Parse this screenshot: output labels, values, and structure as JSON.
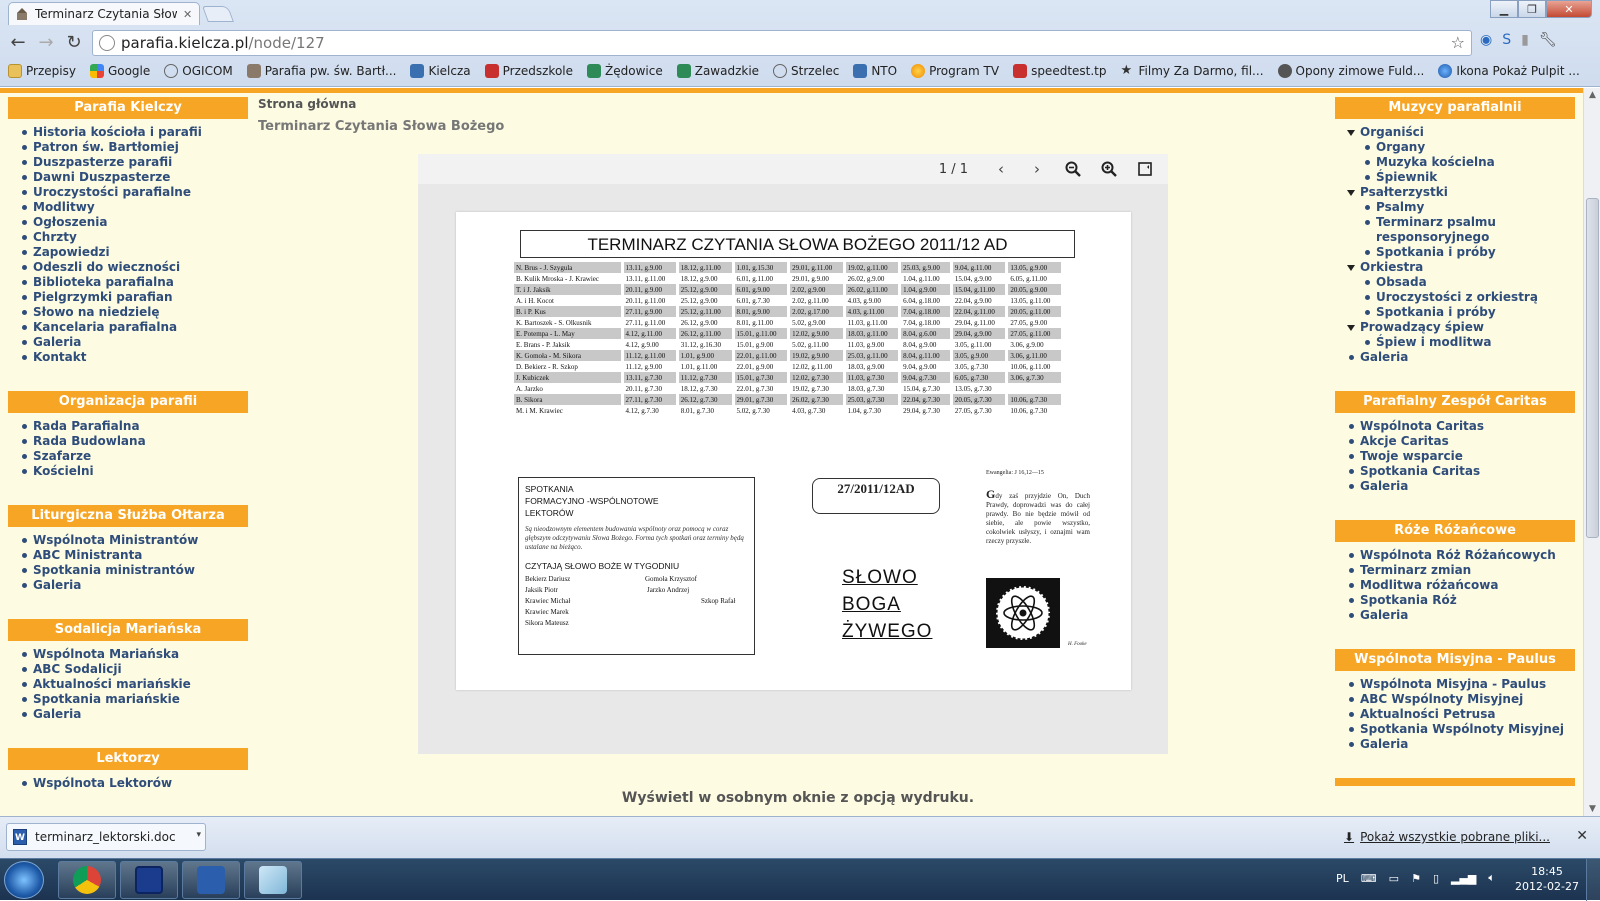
{
  "browser": {
    "tab_title": "Terminarz Czytania Słowa B",
    "url_host": "parafia.kielcza.pl",
    "url_path": "/node/127",
    "bookmarks": [
      {
        "label": "Przepisy",
        "icon": "folder-icon"
      },
      {
        "label": "Google",
        "icon": "google-icon"
      },
      {
        "label": "OGICOM",
        "icon": "ogicom-icon"
      },
      {
        "label": "Parafia pw. św. Bartł...",
        "icon": "church-icon"
      },
      {
        "label": "Kielcza",
        "icon": "kielcza-icon"
      },
      {
        "label": "Przedszkole",
        "icon": "school-icon"
      },
      {
        "label": "Żędowice",
        "icon": "zedowice-icon"
      },
      {
        "label": "Zawadzkie",
        "icon": "zawadzkie-icon"
      },
      {
        "label": "Strzelec",
        "icon": "strzelec-icon"
      },
      {
        "label": "NTO",
        "icon": "nto-icon"
      },
      {
        "label": "Program TV",
        "icon": "tv-icon"
      },
      {
        "label": "speedtest.tp",
        "icon": "speedtest-icon"
      },
      {
        "label": "Filmy Za Darmo, fil...",
        "icon": "star-icon"
      },
      {
        "label": "Opony zimowe Fuld...",
        "icon": "tire-icon"
      },
      {
        "label": "Ikona Pokaż Pulpit ...",
        "icon": "globe-icon"
      }
    ]
  },
  "page": {
    "breadcrumb": "Strona główna",
    "title": "Terminarz Czytania Słowa Bożego",
    "print_link": "Wyświetl w osobnym oknie z opcją wydruku."
  },
  "left_sidebar": [
    {
      "title": "Parafia Kielczy",
      "items": [
        "Historia kościoła i parafii",
        "Patron św. Bartłomiej",
        "Duszpasterze parafii",
        "Dawni Duszpasterze",
        "Uroczystości parafialne",
        "Modlitwy",
        "Ogłoszenia",
        "Chrzty",
        "Zapowiedzi",
        "Odeszli do wieczności",
        "Biblioteka parafialna",
        "Pielgrzymki parafian",
        "Słowo na niedzielę",
        "Kancelaria parafialna",
        "Galeria",
        "Kontakt"
      ]
    },
    {
      "title": "Organizacja parafii",
      "items": [
        "Rada Parafialna",
        "Rada Budowlana",
        "Szafarze",
        "Kościelni"
      ]
    },
    {
      "title": "Liturgiczna Służba Ołtarza",
      "items": [
        "Wspólnota Ministrantów",
        "ABC Ministranta",
        "Spotkania ministrantów",
        "Galeria"
      ]
    },
    {
      "title": "Sodalicja Mariańska",
      "items": [
        "Wspólnota Mariańska",
        "ABC Sodalicji",
        "Aktualności mariańskie",
        "Spotkania mariańskie",
        "Galeria"
      ]
    },
    {
      "title": "Lektorzy",
      "items": [
        "Wspólnota Lektorów"
      ]
    }
  ],
  "right_sidebar": [
    {
      "title": "Muzycy parafialnii",
      "items": [
        {
          "label": "Organiści",
          "level": 0
        },
        {
          "label": "Organy",
          "level": 1
        },
        {
          "label": "Muzyka kościelna",
          "level": 1
        },
        {
          "label": "Śpiewnik",
          "level": 1
        },
        {
          "label": "Psałterzystki",
          "level": 0
        },
        {
          "label": "Psalmy",
          "level": 1
        },
        {
          "label": "Terminarz psalmu responsoryjnego",
          "level": 1
        },
        {
          "label": "Spotkania i próby",
          "level": 1
        },
        {
          "label": "Orkiestra",
          "level": 0
        },
        {
          "label": "Obsada",
          "level": 1
        },
        {
          "label": "Uroczystości z orkiestrą",
          "level": 1
        },
        {
          "label": "Spotkania i próby",
          "level": 1
        },
        {
          "label": "Prowadzący śpiew",
          "level": 0
        },
        {
          "label": "Śpiew i modlitwa",
          "level": 1
        },
        {
          "label": "Galeria",
          "level": 2
        }
      ]
    },
    {
      "title": "Parafialny Zespół Caritas",
      "items": [
        {
          "label": "Wspólnota Caritas",
          "level": 2
        },
        {
          "label": "Akcje Caritas",
          "level": 2
        },
        {
          "label": "Twoje wsparcie",
          "level": 2
        },
        {
          "label": "Spotkania Caritas",
          "level": 2
        },
        {
          "label": "Galeria",
          "level": 2
        }
      ]
    },
    {
      "title": "Róże Różańcowe",
      "items": [
        {
          "label": "Wspólnota Róż Różańcowych",
          "level": 2
        },
        {
          "label": "Terminarz zmian",
          "level": 2
        },
        {
          "label": "Modlitwa różańcowa",
          "level": 2
        },
        {
          "label": "Spotkania Róż",
          "level": 2
        },
        {
          "label": "Galeria",
          "level": 2
        }
      ]
    },
    {
      "title": "Wspólnota Misyjna - Paulus",
      "items": [
        {
          "label": "Wspólnota Misyjna - Paulus",
          "level": 2
        },
        {
          "label": "ABC Wspólnoty Misyjnej",
          "level": 2
        },
        {
          "label": "Aktualności Petrusa",
          "level": 2
        },
        {
          "label": "Spotkania Wspólnoty Misyjnej",
          "level": 2
        },
        {
          "label": "Galeria",
          "level": 2
        }
      ]
    }
  ],
  "viewer": {
    "page_indicator": "1 / 1"
  },
  "document": {
    "title": "TERMINARZ CZYTANIA SŁOWA BOŻEGO  2011/12 AD",
    "schedule": [
      {
        "name": "N. Brus - J. Szygula",
        "dates": [
          "13.11, g.9.00",
          "18.12, g.11.00",
          "1.01, g.15.30",
          "29.01, g.11.00",
          "19.02, g.11.00",
          "25.03, g.9.00",
          "9.04, g.11.00",
          "13.05, g.9.00"
        ]
      },
      {
        "name": "B. Kulik Mroska - J. Krawiec",
        "dates": [
          "13.11, g.11.00",
          "18.12, g.9.00",
          "6.01, g.11.00",
          "29.01, g.9.00",
          "26.02, g.9.00",
          "1.04, g.11.00",
          "15.04, g.9.00",
          "6.05, g.11.00"
        ]
      },
      {
        "name": "T. i J. Jaksik",
        "dates": [
          "20.11, g.9.00",
          "25.12, g.9.00",
          "6.01, g.9.00",
          "2.02, g.9.00",
          "26.02, g.11.00",
          "1.04, g.9.00",
          "15.04, g.11.00",
          "20.05, g.9.00"
        ]
      },
      {
        "name": "A. i H. Kocot",
        "dates": [
          "20.11, g.11.00",
          "25.12, g.9.00",
          "6.01, g.7.30",
          "2.02, g.11.00",
          "4.03, g.9.00",
          "6.04, g.18.00",
          "22.04, g.9.00",
          "13.05, g.11.00"
        ]
      },
      {
        "name": "B. i P. Kus",
        "dates": [
          "27.11, g.9.00",
          "25.12, g.11.00",
          "8.01, g.9.00",
          "2.02, g.17.00",
          "4.03, g.11.00",
          "7.04, g.18.00",
          "22.04, g.11.00",
          "20.05, g.11.00"
        ]
      },
      {
        "name": "K. Bartoszek - S. Olkusnik",
        "dates": [
          "27.11, g.11.00",
          "26.12, g.9.00",
          "8.01, g.11.00",
          "5.02, g.9.00",
          "11.03, g.11.00",
          "7.04, g.18.00",
          "29.04, g.11.00",
          "27.05, g.9.00"
        ]
      },
      {
        "name": "E. Potempa - L. May",
        "dates": [
          "4.12, g.11.00",
          "26.12, g.11.00",
          "15.01, g.11.00",
          "12.02, g.9.00",
          "18.03, g.11.00",
          "8.04, g.6.00",
          "29.04, g.9.00",
          "27.05, g.11.00"
        ]
      },
      {
        "name": "E. Brans - P. Jaksik",
        "dates": [
          "4.12, g.9.00",
          "31.12, g.16.30",
          "15.01, g.9.00",
          "5.02, g.11.00",
          "11.03, g.9.00",
          "8.04, g.9.00",
          "3.05, g.11.00",
          "3.06, g.9.00"
        ]
      },
      {
        "name": "K. Gomoła - M. Sikora",
        "dates": [
          "11.12, g.11.00",
          "1.01, g.9.00",
          "22.01, g.11.00",
          "19.02, g.9.00",
          "25.03, g.11.00",
          "8.04, g.11.00",
          "3.05, g.9.00",
          "3.06, g.11.00"
        ]
      },
      {
        "name": "D. Bekierz - R. Szkop",
        "dates": [
          "11.12, g.9.00",
          "1.01, g.11.00",
          "22.01, g.9.00",
          "12.02, g.11.00",
          "18.03, g.9.00",
          "9.04, g.9.00",
          "3.05, g.7.30",
          "10.06, g.11.00"
        ]
      },
      {
        "name": "J. Kubiczek",
        "dates": [
          "13.11, g.7.30",
          "11.12, g.7.30",
          "15.01, g.7.30",
          "12.02, g.7.30",
          "11.03, g.7.30",
          "9.04, g.7.30",
          "6.05, g.7.30",
          "3.06, g.7.30"
        ]
      },
      {
        "name": "A. Jarzko",
        "dates": [
          "20.11, g.7.30",
          "18.12, g.7.30",
          "22.01, g.7.30",
          "19.02, g.7.30",
          "18.03, g.7.30",
          "15.04, g.7.30",
          "13.05, g.7.30",
          ""
        ]
      },
      {
        "name": "B. Sikora",
        "dates": [
          "27.11, g.7.30",
          "26.12, g.7.30",
          "29.01, g.7.30",
          "26.02, g.7.30",
          "25.03, g.7.30",
          "22.04, g.7.30",
          "20.05, g.7.30",
          "10.06, g.7.30"
        ]
      },
      {
        "name": "M. i M. Krawiec",
        "dates": [
          "4.12, g.7.30",
          "8.01, g.7.30",
          "5.02, g.7.30",
          "4.03, g.7.30",
          "1.04, g.7.30",
          "29.04, g.7.30",
          "27.05, g.7.30",
          "10.06, g.7.30"
        ]
      }
    ],
    "box_heading_1": "SPOTKANIA",
    "box_heading_2": "FORMACYJNO -WSPÓLNOTOWE",
    "box_heading_3": "LEKTORÓW",
    "box_italic": "Są nieodzownym elementem budowania wspólnoty oraz pomocą w coraz głębszym odczytywaniu Słowa Bożego. Forma tych spotkań oraz terminy będą ustalane na bieżąco.",
    "box_week_heading": "CZYTAJĄ SŁOWO BOŻE W TYGODNIU",
    "week_readers": [
      "Bekierz Dariusz",
      "Jaksik Piotr",
      "Krawiec Michał",
      "Krawiec Marek",
      "Sikora Mateusz",
      "Gomoła Krzysztof",
      "Jarzko Andrzej",
      "Szkop Rafał"
    ],
    "scroll_label": "27/2011/12AD",
    "slowo_1": "SŁOWO",
    "slowo_2": "BOGA",
    "slowo_3": "ŻYWEGO",
    "gospel_ref": "Ewangelia: J 16,12—15",
    "gospel_initial": "G",
    "gospel_text": "dy zaś przyjdzie On, Duch Prawdy, doprowadzi was do całej prawdy. Bo nie będzie mówił od siebie, ale powie wszystko, cokolwiek usłyszy, i oznajmi wam rzeczy przyszłe.",
    "author": "H. Fooke"
  },
  "downloads": {
    "file_name": "terminarz_lektorski.doc",
    "file_icon_label": "W",
    "show_all": "Pokaż wszystkie pobrane pliki..."
  },
  "taskbar": {
    "lang": "PL",
    "time": "18:45",
    "date": "2012-02-27"
  },
  "colors": {
    "accent": "#f6a524",
    "page_bg": "#fdfbe2",
    "link": "#2f4d7a"
  }
}
